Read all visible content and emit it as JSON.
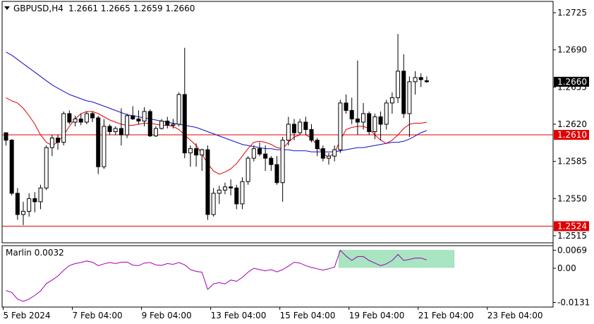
{
  "header": {
    "symbol": "GBPUSD,H4",
    "ohlc": "1.2661 1.2665 1.2659 1.2660"
  },
  "indicator": {
    "name_value": "Marlin 0.0032"
  },
  "colors": {
    "bull": "#ffffff",
    "bear": "#000000",
    "ma_fast": "#e00000",
    "ma_slow": "#1010cc",
    "osc": "#a000b0",
    "zone": "#a8e6c2",
    "level_line": "#e00000",
    "price_label_bg": "#e00000"
  },
  "chart_data": [
    {
      "type": "candlestick",
      "title": "GBPUSD,H4",
      "x_ticks": [
        "5 Feb 2024",
        "7 Feb 04:00",
        "9 Feb 04:00",
        "13 Feb 04:00",
        "15 Feb 04:00",
        "19 Feb 04:00",
        "21 Feb 04:00",
        "23 Feb 04:00"
      ],
      "y_ticks": [
        1.2725,
        1.269,
        1.2655,
        1.262,
        1.2585,
        1.255,
        1.2515
      ],
      "ylim": [
        1.2509,
        1.2735
      ],
      "current_price": 1.266,
      "levels": [
        1.261,
        1.2524
      ],
      "candles": [
        [
          1.2612,
          1.2612,
          1.26,
          1.2605
        ],
        [
          1.2605,
          1.2606,
          1.2553,
          1.2555
        ],
        [
          1.2555,
          1.256,
          1.253,
          1.2535
        ],
        [
          1.2535,
          1.2547,
          1.2525,
          1.2538
        ],
        [
          1.2538,
          1.2555,
          1.2533,
          1.255
        ],
        [
          1.255,
          1.2556,
          1.2537,
          1.2547
        ],
        [
          1.2547,
          1.2563,
          1.254,
          1.256
        ],
        [
          1.256,
          1.26,
          1.2558,
          1.2598
        ],
        [
          1.2598,
          1.261,
          1.259,
          1.2607
        ],
        [
          1.2607,
          1.261,
          1.2596,
          1.2603
        ],
        [
          1.2603,
          1.2632,
          1.26,
          1.263
        ],
        [
          1.263,
          1.2633,
          1.262,
          1.2622
        ],
        [
          1.2622,
          1.2628,
          1.2618,
          1.2625
        ],
        [
          1.2625,
          1.263,
          1.2619,
          1.2622
        ],
        [
          1.2622,
          1.2632,
          1.262,
          1.263
        ],
        [
          1.263,
          1.2632,
          1.2622,
          1.2626
        ],
        [
          1.2626,
          1.2628,
          1.2573,
          1.258
        ],
        [
          1.258,
          1.2625,
          1.2578,
          1.2618
        ],
        [
          1.2618,
          1.262,
          1.261,
          1.2613
        ],
        [
          1.2613,
          1.2618,
          1.261,
          1.2616
        ],
        [
          1.2616,
          1.2635,
          1.26,
          1.261
        ],
        [
          1.261,
          1.263,
          1.2607,
          1.2628
        ],
        [
          1.2628,
          1.2637,
          1.2624,
          1.2625
        ],
        [
          1.2625,
          1.2633,
          1.262,
          1.2623
        ],
        [
          1.2623,
          1.2636,
          1.2618,
          1.2632
        ],
        [
          1.2632,
          1.2634,
          1.2608,
          1.2609
        ],
        [
          1.2609,
          1.2618,
          1.2608,
          1.2616
        ],
        [
          1.2616,
          1.2625,
          1.2615,
          1.2623
        ],
        [
          1.2623,
          1.2627,
          1.2616,
          1.2619
        ],
        [
          1.2619,
          1.2625,
          1.2616,
          1.262
        ],
        [
          1.262,
          1.265,
          1.2618,
          1.2648
        ],
        [
          1.2648,
          1.2692,
          1.2588,
          1.2593
        ],
        [
          1.2593,
          1.26,
          1.258,
          1.2597
        ],
        [
          1.2597,
          1.2602,
          1.258,
          1.2591
        ],
        [
          1.2591,
          1.2597,
          1.2576,
          1.2596
        ],
        [
          1.2596,
          1.26,
          1.253,
          1.2535
        ],
        [
          1.2535,
          1.256,
          1.2533,
          1.2555
        ],
        [
          1.2555,
          1.2562,
          1.2545,
          1.2558
        ],
        [
          1.2558,
          1.2565,
          1.2554,
          1.2561
        ],
        [
          1.2561,
          1.2568,
          1.2553,
          1.256
        ],
        [
          1.256,
          1.2563,
          1.254,
          1.2545
        ],
        [
          1.2545,
          1.257,
          1.254,
          1.2566
        ],
        [
          1.2566,
          1.259,
          1.2563,
          1.2588
        ],
        [
          1.2588,
          1.26,
          1.2585,
          1.2597
        ],
        [
          1.2597,
          1.2603,
          1.259,
          1.2592
        ],
        [
          1.2592,
          1.26,
          1.2576,
          1.2588
        ],
        [
          1.2588,
          1.259,
          1.2576,
          1.2582
        ],
        [
          1.2582,
          1.259,
          1.2563,
          1.2565
        ],
        [
          1.2565,
          1.2608,
          1.2547,
          1.2605
        ],
        [
          1.2605,
          1.2627,
          1.26,
          1.262
        ],
        [
          1.262,
          1.2625,
          1.2605,
          1.2612
        ],
        [
          1.2612,
          1.2625,
          1.261,
          1.2622
        ],
        [
          1.2622,
          1.2627,
          1.261,
          1.2615
        ],
        [
          1.2615,
          1.262,
          1.2603,
          1.2605
        ],
        [
          1.2605,
          1.2607,
          1.259,
          1.2597
        ],
        [
          1.2597,
          1.26,
          1.2585,
          1.2588
        ],
        [
          1.2588,
          1.2593,
          1.2582,
          1.259
        ],
        [
          1.259,
          1.26,
          1.2585,
          1.2596
        ],
        [
          1.2596,
          1.2643,
          1.2593,
          1.264
        ],
        [
          1.264,
          1.2648,
          1.263,
          1.2633
        ],
        [
          1.2633,
          1.2645,
          1.262,
          1.2625
        ],
        [
          1.2625,
          1.268,
          1.261,
          1.2622
        ],
        [
          1.2622,
          1.264,
          1.2615,
          1.263
        ],
        [
          1.263,
          1.2632,
          1.261,
          1.2613
        ],
        [
          1.2613,
          1.263,
          1.2606,
          1.2627
        ],
        [
          1.2627,
          1.2632,
          1.2605,
          1.262
        ],
        [
          1.262,
          1.2643,
          1.2615,
          1.264
        ],
        [
          1.264,
          1.265,
          1.263,
          1.2645
        ],
        [
          1.2645,
          1.2705,
          1.264,
          1.267
        ],
        [
          1.267,
          1.2686,
          1.2626,
          1.263
        ],
        [
          1.263,
          1.2665,
          1.2608,
          1.266
        ],
        [
          1.266,
          1.267,
          1.2648,
          1.2664
        ],
        [
          1.2664,
          1.2668,
          1.2655,
          1.2662
        ],
        [
          1.2661,
          1.2665,
          1.2659,
          1.266
        ]
      ],
      "ma_fast": [
        1.2645,
        1.2642,
        1.264,
        1.2635,
        1.2628,
        1.262,
        1.261,
        1.2603,
        1.26,
        1.2603,
        1.261,
        1.2618,
        1.2625,
        1.263,
        1.2632,
        1.2632,
        1.263,
        1.2627,
        1.2624,
        1.2622,
        1.262,
        1.2619,
        1.2619,
        1.262,
        1.2621,
        1.2621,
        1.262,
        1.2619,
        1.2619,
        1.2618,
        1.2615,
        1.261,
        1.2605,
        1.26,
        1.2592,
        1.2583,
        1.2576,
        1.2573,
        1.2575,
        1.2578,
        1.2583,
        1.259,
        1.2597,
        1.2603,
        1.2604,
        1.2603,
        1.2601,
        1.2598,
        1.2597,
        1.2603,
        1.2608,
        1.261,
        1.261,
        1.2607,
        1.26,
        1.2592,
        1.2589,
        1.2593,
        1.2605,
        1.2615,
        1.2617,
        1.2618,
        1.2618,
        1.2616,
        1.261,
        1.2605,
        1.2602,
        1.2605,
        1.261,
        1.2616,
        1.262,
        1.2621,
        1.2621,
        1.2622
      ],
      "ma_slow": [
        1.2688,
        1.2685,
        1.2681,
        1.2677,
        1.2673,
        1.2669,
        1.2665,
        1.2661,
        1.2657,
        1.2654,
        1.2651,
        1.2648,
        1.2646,
        1.2644,
        1.2642,
        1.2641,
        1.2639,
        1.2637,
        1.2635,
        1.2633,
        1.2631,
        1.2629,
        1.2628,
        1.2627,
        1.2626,
        1.2625,
        1.2624,
        1.2623,
        1.2622,
        1.2621,
        1.262,
        1.2619,
        1.2618,
        1.2617,
        1.2615,
        1.2613,
        1.2611,
        1.2609,
        1.2607,
        1.2605,
        1.2603,
        1.2601,
        1.26,
        1.2599,
        1.2598,
        1.2597,
        1.2597,
        1.2596,
        1.2596,
        1.2596,
        1.2595,
        1.2595,
        1.2595,
        1.2594,
        1.2594,
        1.2594,
        1.2594,
        1.2594,
        1.2595,
        1.2596,
        1.2597,
        1.2598,
        1.2598,
        1.2599,
        1.26,
        1.2601,
        1.2602,
        1.2603,
        1.2603,
        1.2604,
        1.2606,
        1.2609,
        1.2612,
        1.2614
      ]
    },
    {
      "type": "line",
      "title": "Marlin 0.0032",
      "y_ticks": [
        0.0069,
        0.0,
        -0.0131
      ],
      "ylim": [
        -0.0146,
        0.0084
      ],
      "series": [
        {
          "name": "Marlin",
          "values": [
            -0.0085,
            -0.0093,
            -0.0118,
            -0.0127,
            -0.0118,
            -0.0104,
            -0.0087,
            -0.0059,
            -0.0045,
            -0.003,
            -0.0008,
            0.001,
            0.0018,
            0.0022,
            0.0028,
            0.0023,
            0.001,
            0.0017,
            0.0022,
            0.0018,
            0.0023,
            0.0024,
            0.0012,
            0.001,
            0.002,
            0.0022,
            0.0013,
            0.0011,
            0.0018,
            0.0015,
            0.0022,
            0.0013,
            -0.0005,
            -0.0012,
            -0.0015,
            -0.0081,
            -0.006,
            -0.0055,
            -0.006,
            -0.0045,
            -0.005,
            -0.0035,
            -0.0015,
            0.0,
            -0.0005,
            -0.001,
            -0.0005,
            -0.0014,
            -0.0005,
            0.0008,
            0.0023,
            0.002,
            0.001,
            0.0003,
            -0.0002,
            -0.0007,
            -0.0002,
            0.0005,
            0.0069,
            0.0047,
            0.003,
            0.0045,
            0.0045,
            0.003,
            0.002,
            0.001,
            0.0017,
            0.003,
            0.0053,
            0.003,
            0.0034,
            0.0039,
            0.0039,
            0.0032
          ]
        }
      ],
      "zone": {
        "from_index": 58,
        "to_index": 78,
        "ymin": 0.0003,
        "ymax": 0.0069
      }
    }
  ]
}
